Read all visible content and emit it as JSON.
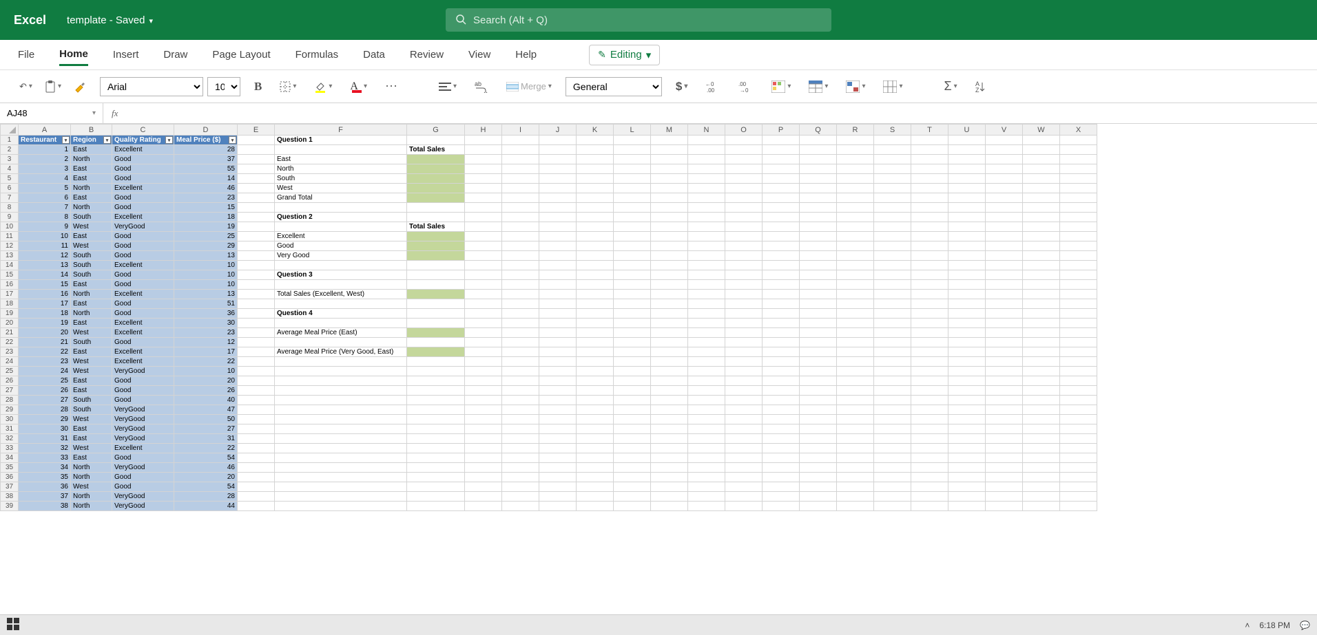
{
  "title": {
    "app": "Excel",
    "doc": "template",
    "state": "- Saved"
  },
  "search": {
    "placeholder": "Search (Alt + Q)"
  },
  "tabs": [
    "File",
    "Home",
    "Insert",
    "Draw",
    "Page Layout",
    "Formulas",
    "Data",
    "Review",
    "View",
    "Help"
  ],
  "active_tab": "Home",
  "editing_label": "Editing",
  "ribbon": {
    "font_name": "Arial",
    "font_size": "10",
    "merge": "Merge",
    "numfmt": "General"
  },
  "namebox": "AJ48",
  "columns": [
    "A",
    "B",
    "C",
    "D",
    "E",
    "F",
    "G",
    "H",
    "I",
    "J",
    "K",
    "L",
    "M",
    "N",
    "O",
    "P",
    "Q",
    "R",
    "S",
    "T",
    "U",
    "V",
    "W",
    "X"
  ],
  "headers": {
    "A": "Restaurant",
    "B": "Region",
    "C": "Quality Rating",
    "D": "Meal Price ($)"
  },
  "data_rows": [
    {
      "n": "1",
      "r1": "1",
      "reg": "East",
      "q": "Excellent",
      "p": "28"
    },
    {
      "n": "2",
      "r1": "2",
      "reg": "North",
      "q": "Good",
      "p": "37"
    },
    {
      "n": "3",
      "r1": "3",
      "reg": "East",
      "q": "Good",
      "p": "55"
    },
    {
      "n": "4",
      "r1": "4",
      "reg": "East",
      "q": "Good",
      "p": "14"
    },
    {
      "n": "5",
      "r1": "5",
      "reg": "North",
      "q": "Excellent",
      "p": "46"
    },
    {
      "n": "6",
      "r1": "6",
      "reg": "East",
      "q": "Good",
      "p": "23"
    },
    {
      "n": "7",
      "r1": "7",
      "reg": "North",
      "q": "Good",
      "p": "15"
    },
    {
      "n": "8",
      "r1": "8",
      "reg": "South",
      "q": "Excellent",
      "p": "18"
    },
    {
      "n": "9",
      "r1": "9",
      "reg": "West",
      "q": "VeryGood",
      "p": "19"
    },
    {
      "n": "10",
      "r1": "10",
      "reg": "East",
      "q": "Good",
      "p": "25"
    },
    {
      "n": "11",
      "r1": "11",
      "reg": "West",
      "q": "Good",
      "p": "29"
    },
    {
      "n": "12",
      "r1": "12",
      "reg": "South",
      "q": "Good",
      "p": "13"
    },
    {
      "n": "13",
      "r1": "13",
      "reg": "South",
      "q": "Excellent",
      "p": "10"
    },
    {
      "n": "14",
      "r1": "14",
      "reg": "South",
      "q": "Good",
      "p": "10"
    },
    {
      "n": "15",
      "r1": "15",
      "reg": "East",
      "q": "Good",
      "p": "10"
    },
    {
      "n": "16",
      "r1": "16",
      "reg": "North",
      "q": "Excellent",
      "p": "13"
    },
    {
      "n": "17",
      "r1": "17",
      "reg": "East",
      "q": "Good",
      "p": "51"
    },
    {
      "n": "18",
      "r1": "18",
      "reg": "North",
      "q": "Good",
      "p": "36"
    },
    {
      "n": "19",
      "r1": "19",
      "reg": "East",
      "q": "Excellent",
      "p": "30"
    },
    {
      "n": "20",
      "r1": "20",
      "reg": "West",
      "q": "Excellent",
      "p": "23"
    },
    {
      "n": "21",
      "r1": "21",
      "reg": "South",
      "q": "Good",
      "p": "12"
    },
    {
      "n": "22",
      "r1": "22",
      "reg": "East",
      "q": "Excellent",
      "p": "17"
    },
    {
      "n": "23",
      "r1": "23",
      "reg": "West",
      "q": "Excellent",
      "p": "22"
    },
    {
      "n": "24",
      "r1": "24",
      "reg": "West",
      "q": "VeryGood",
      "p": "10"
    },
    {
      "n": "25",
      "r1": "25",
      "reg": "East",
      "q": "Good",
      "p": "20"
    },
    {
      "n": "26",
      "r1": "26",
      "reg": "East",
      "q": "Good",
      "p": "26"
    },
    {
      "n": "27",
      "r1": "27",
      "reg": "South",
      "q": "Good",
      "p": "40"
    },
    {
      "n": "28",
      "r1": "28",
      "reg": "South",
      "q": "VeryGood",
      "p": "47"
    },
    {
      "n": "29",
      "r1": "29",
      "reg": "West",
      "q": "VeryGood",
      "p": "50"
    },
    {
      "n": "30",
      "r1": "30",
      "reg": "East",
      "q": "VeryGood",
      "p": "27"
    },
    {
      "n": "31",
      "r1": "31",
      "reg": "East",
      "q": "VeryGood",
      "p": "31"
    },
    {
      "n": "32",
      "r1": "32",
      "reg": "West",
      "q": "Excellent",
      "p": "22"
    },
    {
      "n": "33",
      "r1": "33",
      "reg": "East",
      "q": "Good",
      "p": "54"
    },
    {
      "n": "34",
      "r1": "34",
      "reg": "North",
      "q": "VeryGood",
      "p": "46"
    },
    {
      "n": "35",
      "r1": "35",
      "reg": "North",
      "q": "Good",
      "p": "20"
    },
    {
      "n": "36",
      "r1": "36",
      "reg": "West",
      "q": "Good",
      "p": "54"
    },
    {
      "n": "37",
      "r1": "37",
      "reg": "North",
      "q": "VeryGood",
      "p": "28"
    },
    {
      "n": "38",
      "r1": "38",
      "reg": "North",
      "q": "VeryGood",
      "p": "44"
    }
  ],
  "fcells": {
    "1": {
      "F": "Question 1",
      "bold": true
    },
    "2": {
      "G": "Total Sales",
      "bold": true
    },
    "3": {
      "F": "East",
      "Ggreen": true
    },
    "4": {
      "F": "North",
      "Ggreen": true
    },
    "5": {
      "F": "South",
      "Ggreen": true
    },
    "6": {
      "F": "West",
      "Ggreen": true
    },
    "7": {
      "F": "Grand Total",
      "Ggreen": true
    },
    "9": {
      "F": "Question 2",
      "bold": true
    },
    "10": {
      "G": "Total Sales",
      "bold": true
    },
    "11": {
      "F": "Excellent",
      "Ggreen": true
    },
    "12": {
      "F": "Good",
      "Ggreen": true
    },
    "13": {
      "F": "Very Good",
      "Ggreen": true
    },
    "15": {
      "F": "Question 3",
      "bold": true
    },
    "17": {
      "F": "Total Sales (Excellent, West)",
      "Ggreen": true
    },
    "19": {
      "F": "Question 4",
      "bold": true
    },
    "21": {
      "F": "Average Meal Price (East)",
      "Ggreen": true
    },
    "23": {
      "F": "Average Meal Price (Very Good, East)",
      "Ggreen": true
    }
  },
  "clock": "6:18 PM"
}
